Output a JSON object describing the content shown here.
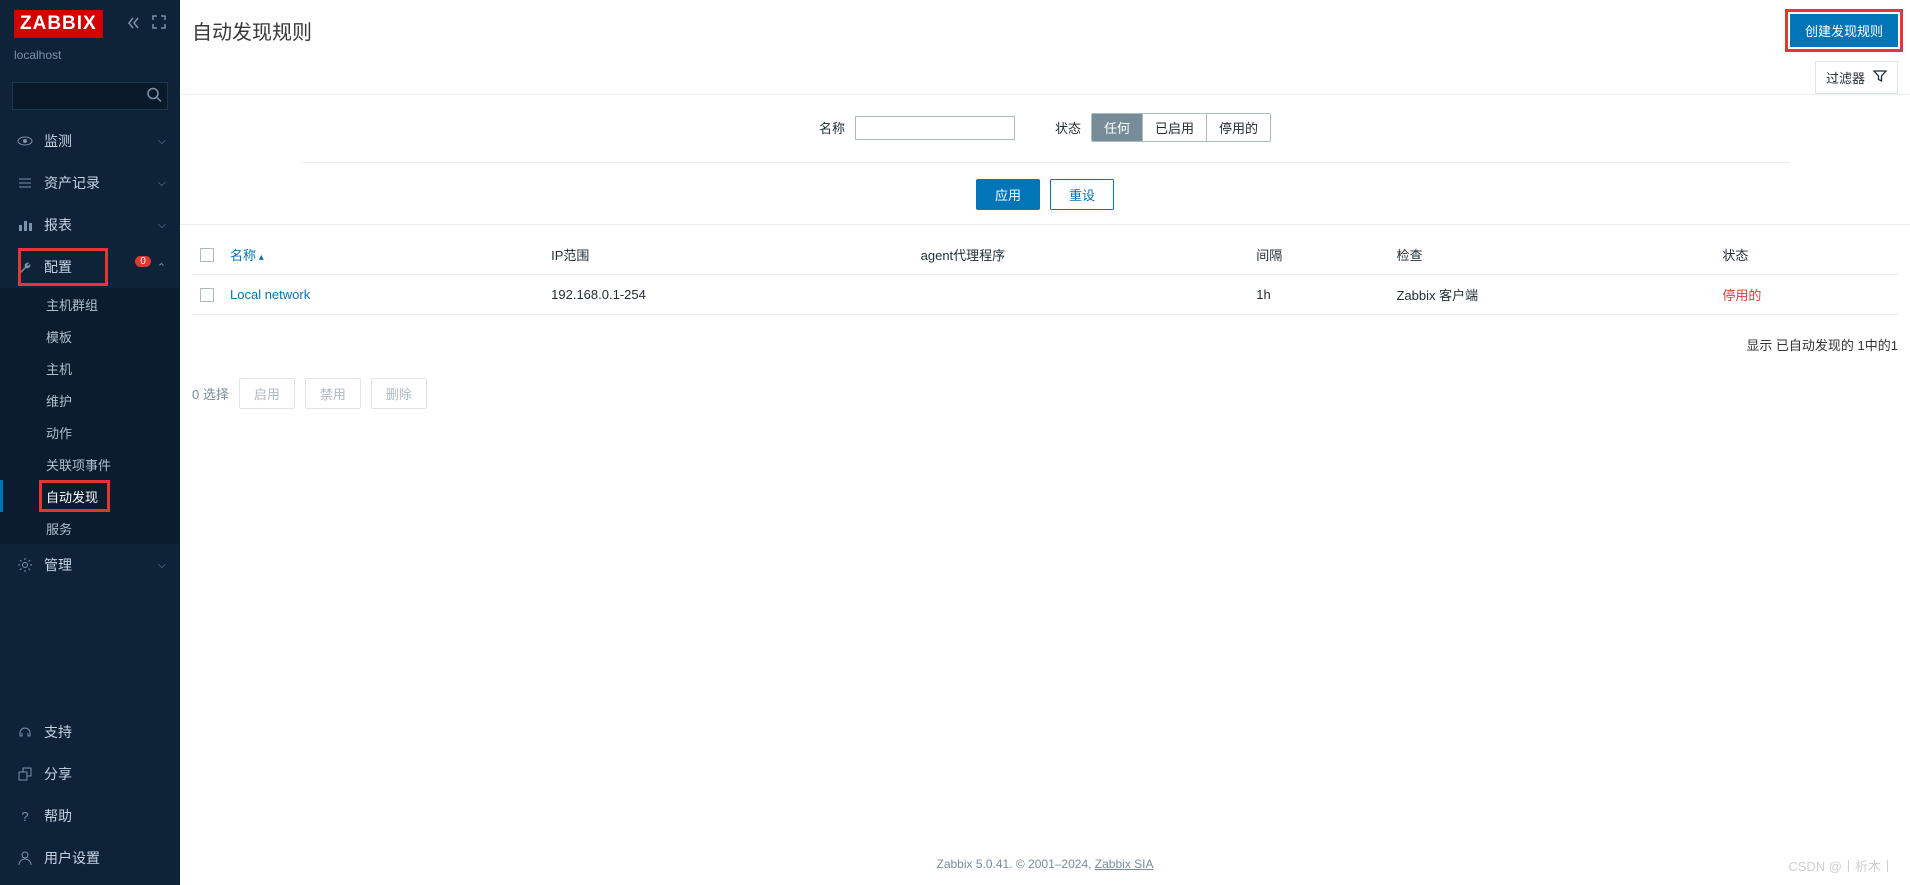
{
  "sidebar": {
    "logo": "ZABBIX",
    "hostname": "localhost",
    "search_placeholder": "",
    "badge": "0",
    "nav": {
      "monitor": "监测",
      "inventory": "资产记录",
      "reports": "报表",
      "config": "配置",
      "admin": "管理"
    },
    "config_sub": {
      "hostgroups": "主机群组",
      "templates": "模板",
      "hosts": "主机",
      "maintenance": "维护",
      "actions": "动作",
      "correlation": "关联项事件",
      "discovery": "自动发现",
      "services": "服务"
    },
    "footer": {
      "support": "支持",
      "share": "分享",
      "help": "帮助",
      "usersettings": "用户设置"
    }
  },
  "page": {
    "title": "自动发现规则",
    "create_btn": "创建发现规则",
    "filter_toggle": "过滤器",
    "filter": {
      "name_label": "名称",
      "name_value": "",
      "status_label": "状态",
      "status_any": "任何",
      "status_enabled": "已启用",
      "status_disabled": "停用的",
      "apply": "应用",
      "reset": "重设"
    },
    "columns": {
      "name": "名称",
      "iprange": "IP范围",
      "proxy": "agent代理程序",
      "interval": "间隔",
      "checks": "检查",
      "status": "状态"
    },
    "rows": [
      {
        "name": "Local network",
        "iprange": "192.168.0.1-254",
        "proxy": "",
        "interval": "1h",
        "checks": "Zabbix 客户端",
        "status": "停用的"
      }
    ],
    "summary": "显示 已自动发现的 1中的1",
    "bulk": {
      "selected": "0 选择",
      "enable": "启用",
      "disable": "禁用",
      "delete": "删除"
    },
    "footer_text": "Zabbix 5.0.41. © 2001–2024, ",
    "footer_link": "Zabbix SIA",
    "watermark": "CSDN @丨析木丨"
  }
}
